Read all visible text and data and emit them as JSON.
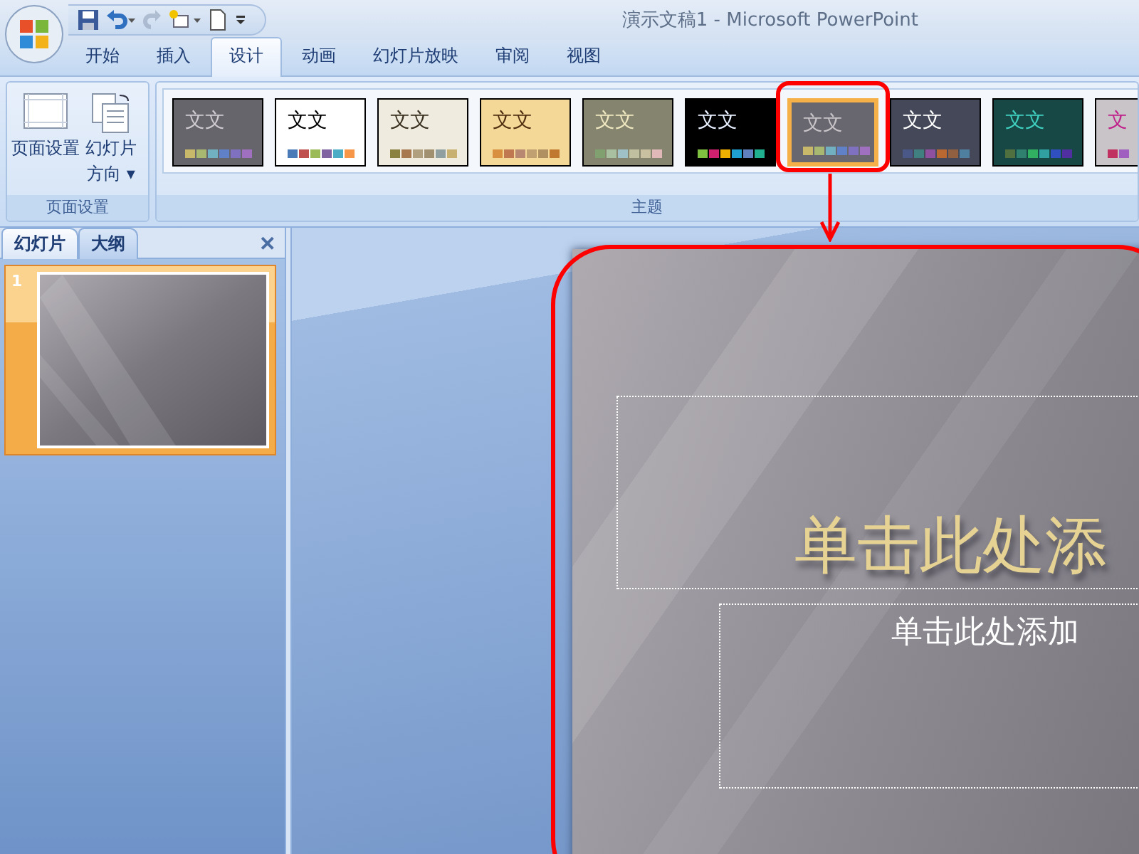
{
  "window": {
    "title": "演示文稿1 - Microsoft PowerPoint"
  },
  "quick_access": [
    {
      "kind": "save",
      "disabled": false
    },
    {
      "kind": "undo",
      "disabled": false
    },
    {
      "kind": "redo",
      "disabled": true
    },
    {
      "kind": "new",
      "disabled": false
    },
    {
      "kind": "blank",
      "disabled": false
    },
    {
      "kind": "more",
      "disabled": false
    }
  ],
  "tabs": [
    {
      "label": "开始",
      "selected": false
    },
    {
      "label": "插入",
      "selected": false
    },
    {
      "label": "设计",
      "selected": true
    },
    {
      "label": "动画",
      "selected": false
    },
    {
      "label": "幻灯片放映",
      "selected": false
    },
    {
      "label": "审阅",
      "selected": false
    },
    {
      "label": "视图",
      "selected": false
    }
  ],
  "page_setup_group": {
    "label": "页面设置",
    "buttons": [
      {
        "kind": "page",
        "label": "页面设置"
      },
      {
        "kind": "orientation",
        "label": "幻灯片",
        "label2": "方向",
        "caret": "▾"
      }
    ]
  },
  "themes_group": {
    "label": "主题",
    "themes": [
      {
        "heading": {
          "label": "文文",
          "color": "#cfcbd0"
        },
        "color": "#67656c",
        "selected": false,
        "swatches": [
          {
            "color": "#c8b86a"
          },
          {
            "color": "#a8b870"
          },
          {
            "color": "#70b0c0"
          },
          {
            "color": "#6080c8"
          },
          {
            "color": "#8070c0"
          },
          {
            "color": "#a070c0"
          }
        ]
      },
      {
        "heading": {
          "label": "文文",
          "color": "#000000"
        },
        "color": "#ffffff",
        "selected": false,
        "swatches": [
          {
            "color": "#4a7ab8"
          },
          {
            "color": "#c0504d"
          },
          {
            "color": "#9bbb59"
          },
          {
            "color": "#8064a2"
          },
          {
            "color": "#4bacc6"
          },
          {
            "color": "#f79646"
          }
        ]
      },
      {
        "heading": {
          "label": "文文",
          "color": "#3a3020"
        },
        "color": "#efebdf",
        "selected": false,
        "swatches": [
          {
            "color": "#8a8040"
          },
          {
            "color": "#a87850"
          },
          {
            "color": "#b0a080"
          },
          {
            "color": "#a09070"
          },
          {
            "color": "#90a0a0"
          },
          {
            "color": "#c8b070"
          }
        ]
      },
      {
        "heading": {
          "label": "文文",
          "color": "#503010"
        },
        "color": "#f3d898",
        "selected": false,
        "swatches": [
          {
            "color": "#d89040"
          },
          {
            "color": "#c07850"
          },
          {
            "color": "#b88870"
          },
          {
            "color": "#c0a070"
          },
          {
            "color": "#b09060"
          },
          {
            "color": "#c07830"
          }
        ]
      },
      {
        "heading": {
          "label": "文文",
          "color": "#f0e8c0"
        },
        "color": "#85856f",
        "selected": false,
        "swatches": [
          {
            "color": "#80a070"
          },
          {
            "color": "#a8c0a0"
          },
          {
            "color": "#a0c0c8"
          },
          {
            "color": "#c0c0a0"
          },
          {
            "color": "#c8c0a0"
          },
          {
            "color": "#e0b8b8"
          }
        ]
      },
      {
        "heading": {
          "label": "文文",
          "color": "#e8f0ff"
        },
        "color": "#000000",
        "selected": false,
        "swatches": [
          {
            "color": "#80c040"
          },
          {
            "color": "#d02070"
          },
          {
            "color": "#f0b000"
          },
          {
            "color": "#20a0d0"
          },
          {
            "color": "#6080c0"
          },
          {
            "color": "#20b090"
          }
        ]
      },
      {
        "heading": {
          "label": "文文",
          "color": "#c8c4c8"
        },
        "color": "#68666e",
        "selected": true,
        "swatches": [
          {
            "color": "#c8b86a"
          },
          {
            "color": "#a8b870"
          },
          {
            "color": "#70b0c0"
          },
          {
            "color": "#6080c8"
          },
          {
            "color": "#8070c0"
          },
          {
            "color": "#a070c0"
          }
        ]
      },
      {
        "heading": {
          "label": "文文",
          "color": "#ffffff"
        },
        "color": "#444858",
        "selected": false,
        "swatches": [
          {
            "color": "#4a5888"
          },
          {
            "color": "#408080"
          },
          {
            "color": "#9050a0"
          },
          {
            "color": "#b86830"
          },
          {
            "color": "#906040"
          },
          {
            "color": "#5080a0"
          }
        ]
      },
      {
        "heading": {
          "label": "文文",
          "color": "#40d0c0"
        },
        "color": "#174845",
        "selected": false,
        "swatches": [
          {
            "color": "#507040"
          },
          {
            "color": "#308070"
          },
          {
            "color": "#30b060"
          },
          {
            "color": "#30a0a0"
          },
          {
            "color": "#3050c0"
          },
          {
            "color": "#5030a0"
          }
        ]
      },
      {
        "heading": {
          "label": "文",
          "color": "#c0208a"
        },
        "color": "#c8c4c8",
        "selected": false,
        "swatches": [
          {
            "color": "#c03060"
          },
          {
            "color": "#a060c0"
          }
        ]
      }
    ]
  },
  "pane": {
    "tabs": [
      {
        "label": "幻灯片",
        "selected": true
      },
      {
        "label": "大纲",
        "selected": false
      }
    ],
    "close": "✕",
    "slides": [
      {
        "number": "1",
        "selected": true
      }
    ]
  },
  "slide": {
    "title_placeholder": "单击此处添",
    "subtitle_placeholder": "单击此处添加"
  },
  "annotations": [
    {
      "kind": "ring"
    },
    {
      "kind": "arrow"
    },
    {
      "kind": "frame"
    }
  ]
}
